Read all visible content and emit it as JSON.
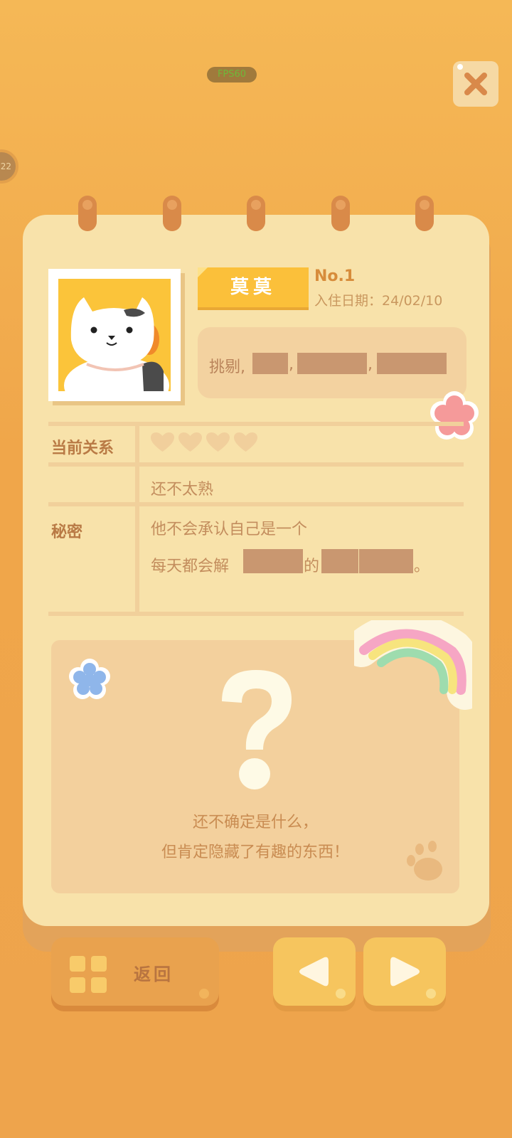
{
  "debug": {
    "fps_label": "FPS60"
  },
  "side_badge": {
    "text": "22"
  },
  "profile": {
    "name": "莫莫",
    "number": "No.1",
    "move_in_date": "入住日期：24/02/10",
    "traits_visible": "挑剔,"
  },
  "relationship": {
    "label": "当前关系",
    "hearts_filled": 0,
    "hearts_total": 4,
    "status": "还不太熟"
  },
  "secret": {
    "label": "秘密",
    "line1": "他不会承认自己是一个",
    "line2_prefix": "每天都会解",
    "line2_mid": "的",
    "line2_end": "。"
  },
  "mystery": {
    "hint_line1": "还不确定是什么，",
    "hint_line2": "但肯定隐藏了有趣的东西！"
  },
  "buttons": {
    "back_label": "返回"
  },
  "colors": {
    "accent_yellow": "#fbc03a",
    "paper": "#f8e2aa",
    "background": "#f0a64a",
    "text_brown": "#b97a45"
  },
  "icons": {
    "close": "close-x-icon",
    "prev": "arrow-left-icon",
    "next": "arrow-right-icon",
    "menu": "grid-icon"
  }
}
